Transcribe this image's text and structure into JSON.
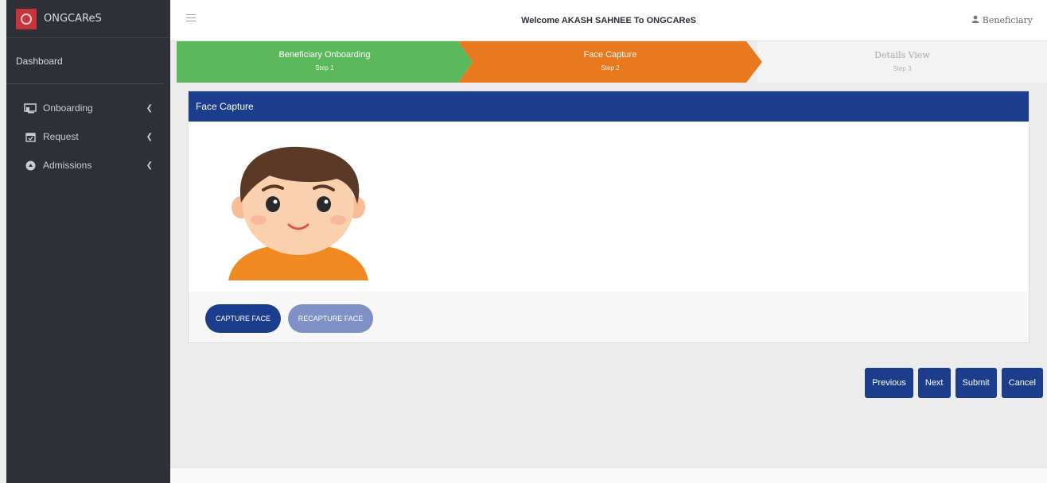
{
  "app": {
    "brand_name": "ONGCAReS",
    "logo_icon": "ongc-logo"
  },
  "sidebar": {
    "dashboard_label": "Dashboard",
    "items": [
      {
        "label": "Onboarding",
        "icon": "onboarding-icon"
      },
      {
        "label": "Request",
        "icon": "calendar-check-icon"
      },
      {
        "label": "Admissions",
        "icon": "admissions-icon"
      }
    ]
  },
  "header": {
    "welcome": "Welcome AKASH SAHNEE To ONGCAReS",
    "user_label": "Beneficiary"
  },
  "stepper": {
    "steps": [
      {
        "title": "Beneficiary Onboarding",
        "sub": "Step 1",
        "state": "done",
        "color": "#5cb85c"
      },
      {
        "title": "Face Capture",
        "sub": "Step 2",
        "state": "active",
        "color": "#e8791e"
      },
      {
        "title": "Details View",
        "sub": "Step 3",
        "state": "pending",
        "color": "#f3f3f3"
      }
    ]
  },
  "card": {
    "title": "Face Capture",
    "capture_label": "CAPTURE FACE",
    "recapture_label": "RECAPTURE FACE"
  },
  "actions": {
    "previous": "Previous",
    "next": "Next",
    "submit": "Submit",
    "cancel": "Cancel"
  },
  "colors": {
    "primary": "#1c3d8c",
    "sidebar_bg": "#2d3137",
    "step_done": "#5cb85c",
    "step_active": "#e8791e"
  }
}
